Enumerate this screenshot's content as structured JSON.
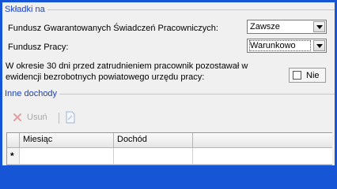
{
  "section_skladki": {
    "title": "Składki na"
  },
  "fgsp": {
    "label": "Fundusz Gwarantowanych Świadczeń Pracowniczych:",
    "value": "Zawsze"
  },
  "fp": {
    "label": "Fundusz Pracy:",
    "value": "Warunkowo"
  },
  "unemployed": {
    "label_line1": "W okresie 30 dni przed zatrudnieniem pracownik pozostawał w",
    "label_line2": "ewidencji bezrobotnych powiatowego urzędu pracy:",
    "checkbox_label": "Nie",
    "checked": false
  },
  "section_inne": {
    "title": "Inne dochody"
  },
  "toolbar": {
    "delete_label": "Usuń",
    "delete_icon": "x-icon",
    "edit_icon": "document-icon"
  },
  "grid": {
    "columns": [
      "Miesiąc",
      "Dochód"
    ],
    "new_row_marker": "*"
  }
}
